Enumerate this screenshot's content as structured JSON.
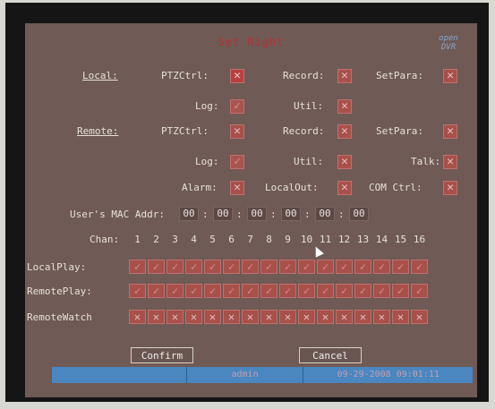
{
  "dialog": {
    "title": "Set Right",
    "logo_line1": "open",
    "logo_line2": "DVR"
  },
  "local": {
    "label": "Local:",
    "perms": [
      {
        "label": "PTZCtrl:",
        "state": "cross"
      },
      {
        "label": "Record:",
        "state": "cross"
      },
      {
        "label": "SetPara:",
        "state": "cross"
      },
      {
        "label": "Log:",
        "state": "check"
      },
      {
        "label": "Util:",
        "state": "cross"
      }
    ]
  },
  "remote": {
    "label": "Remote:",
    "perms": [
      {
        "label": "PTZCtrl:",
        "state": "cross"
      },
      {
        "label": "Record:",
        "state": "cross"
      },
      {
        "label": "SetPara:",
        "state": "cross"
      },
      {
        "label": "Log:",
        "state": "check"
      },
      {
        "label": "Util:",
        "state": "cross"
      },
      {
        "label": "Talk:",
        "state": "cross"
      },
      {
        "label": "Alarm:",
        "state": "cross"
      },
      {
        "label": "LocalOut:",
        "state": "cross"
      },
      {
        "label": "COM Ctrl:",
        "state": "cross"
      }
    ]
  },
  "mac": {
    "label": "User's MAC Addr:",
    "octets": [
      "00",
      "00",
      "00",
      "00",
      "00",
      "00"
    ],
    "separator": ":"
  },
  "channels": {
    "label": "Chan:",
    "numbers": [
      "1",
      "2",
      "3",
      "4",
      "5",
      "6",
      "7",
      "8",
      "9",
      "10",
      "11",
      "12",
      "13",
      "14",
      "15",
      "16"
    ]
  },
  "rows": [
    {
      "label": "LocalPlay:",
      "state": "check"
    },
    {
      "label": "RemotePlay:",
      "state": "check"
    },
    {
      "label": "RemoteWatch",
      "state": "cross"
    }
  ],
  "buttons": {
    "confirm": "Confirm",
    "cancel": "Cancel"
  },
  "status": {
    "user": "admin",
    "datetime": "09-29-2008 09:01:11"
  },
  "icons": {
    "check": "✓",
    "cross": "✕"
  }
}
